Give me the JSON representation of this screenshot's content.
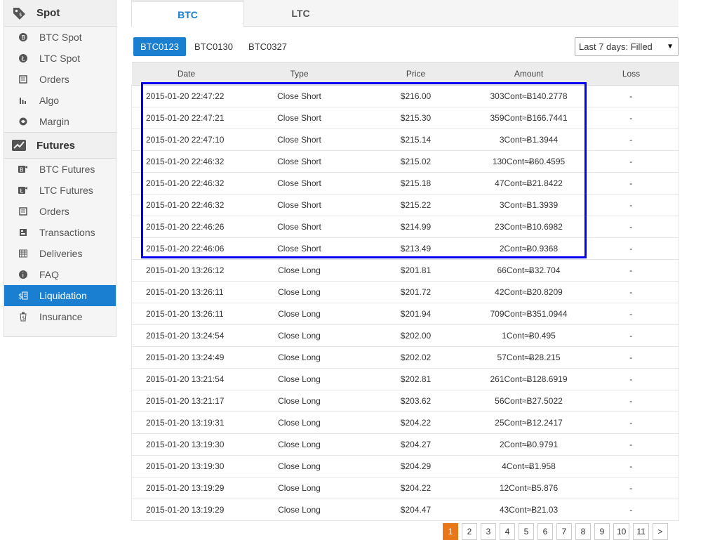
{
  "sidebar": {
    "spot": {
      "title": "Spot",
      "items": [
        {
          "label": "BTC Spot",
          "icon": "btc-coin-icon"
        },
        {
          "label": "LTC Spot",
          "icon": "ltc-coin-icon"
        },
        {
          "label": "Orders",
          "icon": "orders-icon"
        },
        {
          "label": "Algo",
          "icon": "bar-chart-icon"
        },
        {
          "label": "Margin",
          "icon": "margin-icon"
        }
      ]
    },
    "futures": {
      "title": "Futures",
      "items": [
        {
          "label": "BTC Futures",
          "icon": "btc-futures-icon"
        },
        {
          "label": "LTC Futures",
          "icon": "ltc-futures-icon"
        },
        {
          "label": "Orders",
          "icon": "orders-icon"
        },
        {
          "label": "Transactions",
          "icon": "transactions-icon"
        },
        {
          "label": "Deliveries",
          "icon": "deliveries-icon"
        },
        {
          "label": "FAQ",
          "icon": "info-icon"
        },
        {
          "label": "Liquidation",
          "icon": "liquidation-icon",
          "active": true
        },
        {
          "label": "Insurance",
          "icon": "insurance-icon"
        }
      ]
    }
  },
  "tabs": [
    {
      "label": "BTC",
      "active": true
    },
    {
      "label": "LTC",
      "active": false
    }
  ],
  "contracts": [
    {
      "label": "BTC0123",
      "active": true
    },
    {
      "label": "BTC0130",
      "active": false
    },
    {
      "label": "BTC0327",
      "active": false
    }
  ],
  "filter": {
    "value": "Last 7 days: Filled"
  },
  "table": {
    "headers": [
      "Date",
      "Type",
      "Price",
      "Amount",
      "Loss"
    ],
    "rows": [
      [
        "2015-01-20 22:47:22",
        "Close Short",
        "$216.00",
        "303Cont≈Ƀ140.2778",
        "-"
      ],
      [
        "2015-01-20 22:47:21",
        "Close Short",
        "$215.30",
        "359Cont≈Ƀ166.7441",
        "-"
      ],
      [
        "2015-01-20 22:47:10",
        "Close Short",
        "$215.14",
        "3Cont≈Ƀ1.3944",
        "-"
      ],
      [
        "2015-01-20 22:46:32",
        "Close Short",
        "$215.02",
        "130Cont≈Ƀ60.4595",
        "-"
      ],
      [
        "2015-01-20 22:46:32",
        "Close Short",
        "$215.18",
        "47Cont≈Ƀ21.8422",
        "-"
      ],
      [
        "2015-01-20 22:46:32",
        "Close Short",
        "$215.22",
        "3Cont≈Ƀ1.3939",
        "-"
      ],
      [
        "2015-01-20 22:46:26",
        "Close Short",
        "$214.99",
        "23Cont≈Ƀ10.6982",
        "-"
      ],
      [
        "2015-01-20 22:46:06",
        "Close Short",
        "$213.49",
        "2Cont≈Ƀ0.9368",
        "-"
      ],
      [
        "2015-01-20 13:26:12",
        "Close Long",
        "$201.81",
        "66Cont≈Ƀ32.704",
        "-"
      ],
      [
        "2015-01-20 13:26:11",
        "Close Long",
        "$201.72",
        "42Cont≈Ƀ20.8209",
        "-"
      ],
      [
        "2015-01-20 13:26:11",
        "Close Long",
        "$201.94",
        "709Cont≈Ƀ351.0944",
        "-"
      ],
      [
        "2015-01-20 13:24:54",
        "Close Long",
        "$202.00",
        "1Cont≈Ƀ0.495",
        "-"
      ],
      [
        "2015-01-20 13:24:49",
        "Close Long",
        "$202.02",
        "57Cont≈Ƀ28.215",
        "-"
      ],
      [
        "2015-01-20 13:21:54",
        "Close Long",
        "$202.81",
        "261Cont≈Ƀ128.6919",
        "-"
      ],
      [
        "2015-01-20 13:21:17",
        "Close Long",
        "$203.62",
        "56Cont≈Ƀ27.5022",
        "-"
      ],
      [
        "2015-01-20 13:19:31",
        "Close Long",
        "$204.22",
        "25Cont≈Ƀ12.2417",
        "-"
      ],
      [
        "2015-01-20 13:19:30",
        "Close Long",
        "$204.27",
        "2Cont≈Ƀ0.9791",
        "-"
      ],
      [
        "2015-01-20 13:19:30",
        "Close Long",
        "$204.29",
        "4Cont≈Ƀ1.958",
        "-"
      ],
      [
        "2015-01-20 13:19:29",
        "Close Long",
        "$204.22",
        "12Cont≈Ƀ5.876",
        "-"
      ],
      [
        "2015-01-20 13:19:29",
        "Close Long",
        "$204.47",
        "43Cont≈Ƀ21.03",
        "-"
      ]
    ]
  },
  "pagination": {
    "pages": [
      "1",
      "2",
      "3",
      "4",
      "5",
      "6",
      "7",
      "8",
      "9",
      "10",
      "11",
      ">"
    ],
    "current": "1"
  },
  "colors": {
    "accent": "#1a7fd0",
    "close_short": "#3a9a3a",
    "close_long": "#d9534f",
    "highlight_box": "#0000ee",
    "pager_active": "#e8771a"
  }
}
